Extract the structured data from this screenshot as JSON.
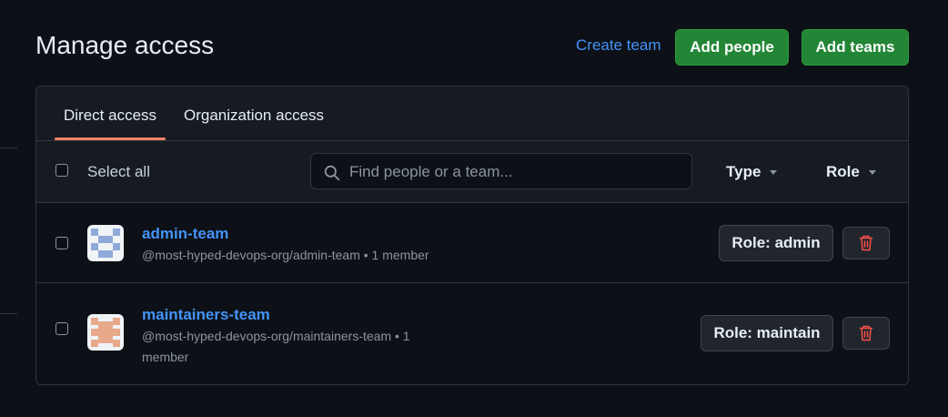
{
  "page": {
    "title": "Manage access",
    "create_team": "Create team",
    "add_people": "Add people",
    "add_teams": "Add teams"
  },
  "tabs": [
    {
      "label": "Direct access",
      "active": true
    },
    {
      "label": "Organization access",
      "active": false
    }
  ],
  "filters": {
    "select_all": "Select all",
    "search_placeholder": "Find people or a team...",
    "type_label": "Type",
    "role_label": "Role"
  },
  "teams": [
    {
      "name": "admin-team",
      "meta_line1": "@most-hyped-devops-org/admin-team • 1 member",
      "meta_line2": "",
      "role": "Role: admin",
      "avatar_color": "#8fa9d8"
    },
    {
      "name": "maintainers-team",
      "meta_line1": "@most-hyped-devops-org/maintainers-team • 1",
      "meta_line2": "member",
      "role": "Role: maintain",
      "avatar_color": "#e8a98a"
    }
  ],
  "colors": {
    "accent_link": "#4493f8",
    "primary_button": "#238636",
    "tab_underline": "#f78166",
    "danger_icon": "#f85149"
  }
}
